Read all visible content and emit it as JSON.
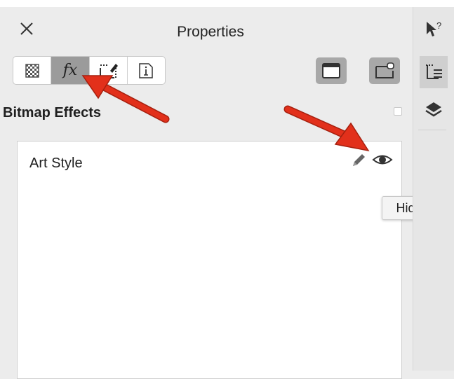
{
  "panel": {
    "title": "Properties",
    "section_title": "Bitmap Effects",
    "effects": [
      {
        "name": "Art Style"
      }
    ],
    "tooltip": "Hide"
  },
  "tabs": [
    {
      "id": "fill",
      "icon": "checkerboard-icon",
      "active": false
    },
    {
      "id": "effects",
      "label": "fx",
      "icon": "fx-icon",
      "active": true
    },
    {
      "id": "outline",
      "icon": "outline-pen-icon",
      "active": false
    },
    {
      "id": "summary",
      "icon": "info-icon",
      "active": false
    }
  ],
  "colors": {
    "accent_arrow": "#e2301b",
    "active_tab": "#9b9b9b",
    "panel_bg": "#ececec"
  }
}
